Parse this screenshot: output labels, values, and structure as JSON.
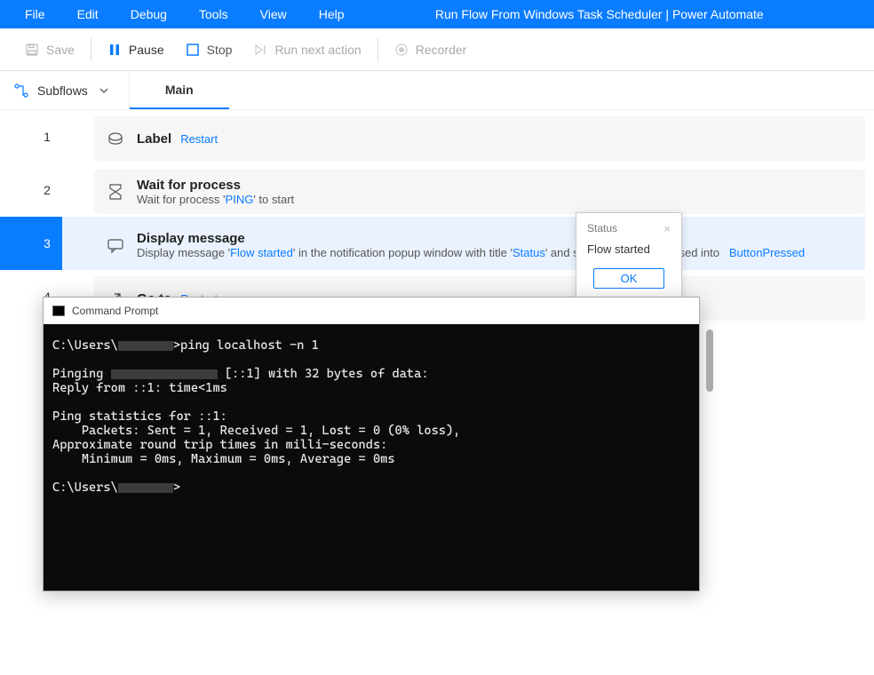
{
  "menu": {
    "items": [
      "File",
      "Edit",
      "Debug",
      "Tools",
      "View",
      "Help"
    ],
    "title": "Run Flow From Windows Task Scheduler | Power Automate"
  },
  "toolbar": {
    "save": "Save",
    "pause": "Pause",
    "stop": "Stop",
    "run_next": "Run next action",
    "recorder": "Recorder"
  },
  "subnav": {
    "subflows": "Subflows",
    "tabs": [
      "Main"
    ]
  },
  "flow": {
    "line_numbers": [
      "1",
      "2",
      "3",
      "4"
    ],
    "selected_index": 2,
    "steps": [
      {
        "icon": "tag",
        "title": "Label",
        "inline_token": "Restart",
        "sub": ""
      },
      {
        "icon": "hourglass",
        "title": "Wait for process",
        "sub_parts": [
          "Wait for process '",
          {
            "tok": "PING"
          },
          "' to start"
        ]
      },
      {
        "icon": "chat",
        "title": "Display message",
        "sub_parts": [
          "Display message '",
          {
            "tok": "Flow started"
          },
          "' in the notification popup window with title '",
          {
            "tok": "Status"
          },
          "' and store the button pressed into ",
          {
            "tok": "ButtonPressed"
          }
        ]
      },
      {
        "icon": "arrow",
        "title": "Go to",
        "inline_token": "Restart",
        "sub": ""
      }
    ]
  },
  "dialog": {
    "title": "Status",
    "body": "Flow started",
    "ok": "OK"
  },
  "cmd": {
    "title": "Command Prompt",
    "lines": [
      "C:\\Users\\████>ping localhost -n 1",
      "",
      "Pinging ████████ [::1] with 32 bytes of data:",
      "Reply from ::1: time<1ms",
      "",
      "Ping statistics for ::1:",
      "    Packets: Sent = 1, Received = 1, Lost = 0 (0% loss),",
      "Approximate round trip times in milli-seconds:",
      "    Minimum = 0ms, Maximum = 0ms, Average = 0ms",
      "",
      "C:\\Users\\████>"
    ]
  }
}
